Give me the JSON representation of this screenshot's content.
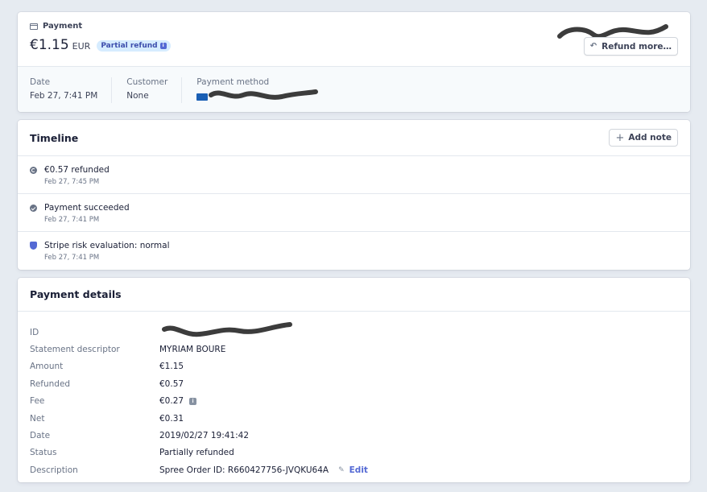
{
  "summary": {
    "eyebrow": "Payment",
    "amount": "€1.15",
    "currency": "EUR",
    "badge": "Partial refund",
    "refund_button": "Refund more…",
    "meta": [
      {
        "label": "Date",
        "value": "Feb 27, 7:41 PM"
      },
      {
        "label": "Customer",
        "value": "None"
      },
      {
        "label": "Payment method",
        "value": ""
      }
    ]
  },
  "timeline": {
    "title": "Timeline",
    "add_note": "Add note",
    "items": [
      {
        "title": "€0.57 refunded",
        "time": "Feb 27, 7:45 PM",
        "icon": "refund-icon"
      },
      {
        "title": "Payment succeeded",
        "time": "Feb 27, 7:41 PM",
        "icon": "check-icon"
      },
      {
        "title": "Stripe risk evaluation: normal",
        "time": "Feb 27, 7:41 PM",
        "icon": "shield-icon"
      }
    ]
  },
  "details": {
    "title": "Payment details",
    "rows": [
      {
        "label": "ID",
        "value": ""
      },
      {
        "label": "Statement descriptor",
        "value": "MYRIAM BOURE"
      },
      {
        "label": "Amount",
        "value": "€1.15"
      },
      {
        "label": "Refunded",
        "value": "€0.57"
      },
      {
        "label": "Fee",
        "value": "€0.27"
      },
      {
        "label": "Net",
        "value": "€0.31"
      },
      {
        "label": "Date",
        "value": "2019/02/27 19:41:42"
      },
      {
        "label": "Status",
        "value": "Partially refunded"
      },
      {
        "label": "Description",
        "value": "Spree Order ID: R660427756-JVQKU64A"
      }
    ],
    "edit_label": "Edit"
  },
  "colors": {
    "accent": "#5469d4",
    "badge_bg": "#d6ecff",
    "redaction": "#3c3c3c"
  }
}
